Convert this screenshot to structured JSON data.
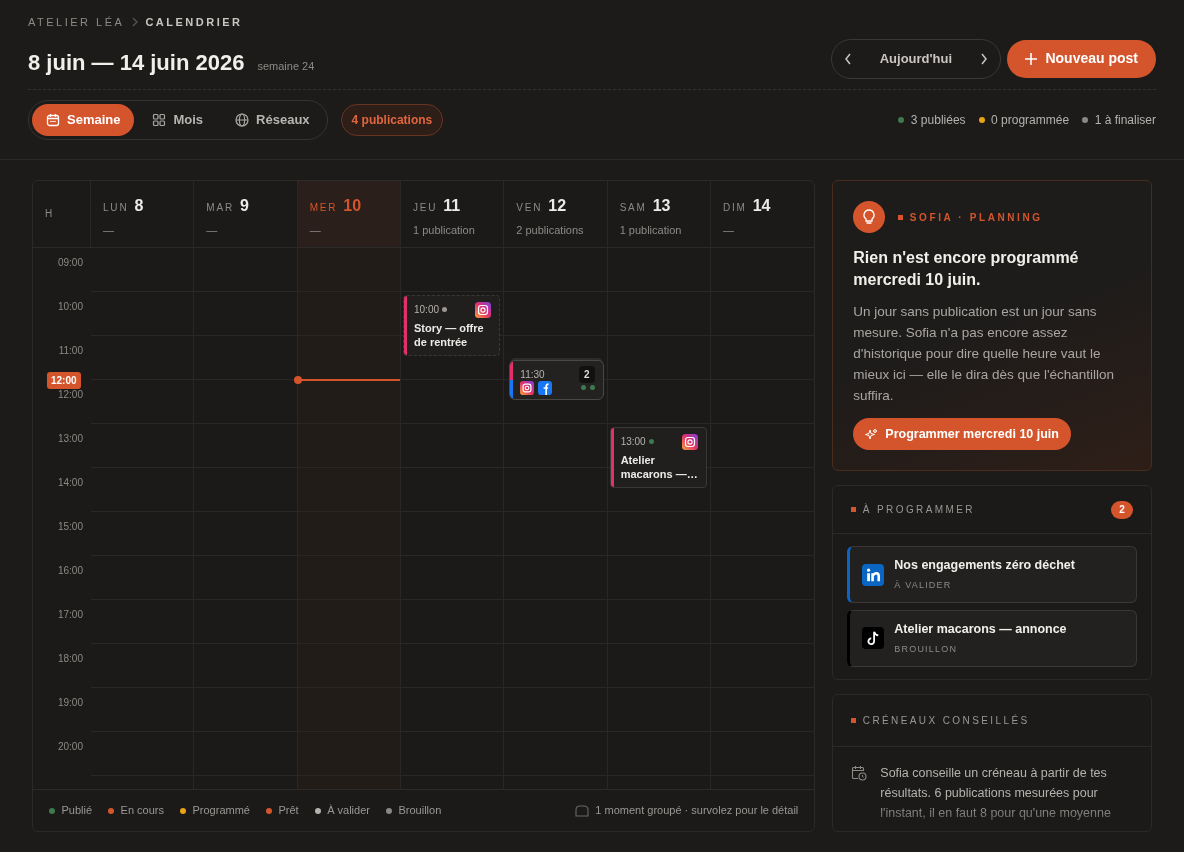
{
  "breadcrumb": [
    {
      "label": "ATELIER LÉA",
      "current": false
    },
    {
      "label": "CALENDRIER",
      "current": true
    }
  ],
  "title": "8 juin — 14 juin 2026",
  "week": "semaine 24",
  "nav": {
    "today": "Aujourd'hui"
  },
  "new_post": "Nouveau post",
  "views": [
    {
      "label": "Semaine",
      "selected": true
    },
    {
      "label": "Mois",
      "selected": false
    },
    {
      "label": "Réseaux",
      "selected": false
    }
  ],
  "count_badge": "4 publications",
  "stats": [
    {
      "label": "3 publiées",
      "color": "#3f7a4e"
    },
    {
      "label": "0 programmée",
      "color": "#e8a317"
    },
    {
      "label": "1 à finaliser",
      "color": "#8a8784"
    }
  ],
  "hour_header": "H",
  "hours": [
    "09:00",
    "10:00",
    "11:00",
    "12:00",
    "13:00",
    "14:00",
    "15:00",
    "16:00",
    "17:00",
    "18:00",
    "19:00",
    "20:00"
  ],
  "now": {
    "label": "12:00"
  },
  "days": [
    {
      "abbr": "LUN",
      "date": "8",
      "summary": "—",
      "selected": false
    },
    {
      "abbr": "MAR",
      "date": "9",
      "summary": "—",
      "selected": false
    },
    {
      "abbr": "MER",
      "date": "10",
      "summary": "—",
      "selected": true
    },
    {
      "abbr": "JEU",
      "date": "11",
      "summary": "1 publication",
      "selected": false,
      "events": [
        {
          "kind": "post",
          "time": "10:00",
          "title": "Story — offre de rentrée",
          "draft": true,
          "networks": [
            {
              "kind": "instagram"
            }
          ],
          "dots": [
            {
              "color": "#9a9794"
            }
          ]
        }
      ]
    },
    {
      "abbr": "VEN",
      "date": "12",
      "summary": "2 publications",
      "selected": false,
      "events": [
        {
          "kind": "group",
          "time": "11:30",
          "count": "2",
          "draft": false,
          "networks": [
            {
              "kind": "instagram"
            },
            {
              "kind": "facebook"
            }
          ],
          "dots": [
            {
              "color": "#3f7a4e"
            },
            {
              "color": "#3f7a4e"
            }
          ]
        }
      ]
    },
    {
      "abbr": "SAM",
      "date": "13",
      "summary": "1 publication",
      "selected": false,
      "events": [
        {
          "kind": "post",
          "time": "13:00",
          "title": "Atelier macarons —…",
          "draft": false,
          "networks": [
            {
              "kind": "instagram"
            }
          ],
          "dots": [
            {
              "color": "#3f7a4e"
            }
          ]
        }
      ]
    },
    {
      "abbr": "DIM",
      "date": "14",
      "summary": "—",
      "selected": false
    }
  ],
  "legend": [
    {
      "label": "Publié",
      "color": "#3f7a4e"
    },
    {
      "label": "En cours",
      "color": "#d4552c"
    },
    {
      "label": "Programmé",
      "color": "#e8a317"
    },
    {
      "label": "Prêt",
      "color": "#d4552c"
    },
    {
      "label": "À valider",
      "color": "#b5b2ae"
    },
    {
      "label": "Brouillon",
      "color": "#8a8784"
    }
  ],
  "group_note": "1 moment groupé · survolez pour le détail",
  "sofia": {
    "eyebrow": "SOFIA · PLANNING",
    "heading": "Rien n'est encore programmé mercredi 10 juin.",
    "body": "Un jour sans publication est un jour sans mesure. Sofia n'a pas encore assez d'historique pour dire quelle heure vaut le mieux ici — elle le dira dès que l'échantillon suffira.",
    "button": "Programmer mercredi 10 juin"
  },
  "to_schedule": {
    "title": "À PROGRAMMER",
    "count": "2",
    "items": [
      {
        "title": "Nos engagements zéro déchet",
        "status": "À VALIDER",
        "kind": "linkedin"
      },
      {
        "title": "Atelier macarons — annonce",
        "status": "BROUILLON",
        "kind": "tiktok"
      }
    ]
  },
  "slots": {
    "title": "CRÉNEAUX CONSEILLÉS",
    "body": "Sofia conseille un créneau à partir de tes résultats. 6 publications mesurées pour l'instant, il en faut 8 pour qu'une moyenne"
  }
}
